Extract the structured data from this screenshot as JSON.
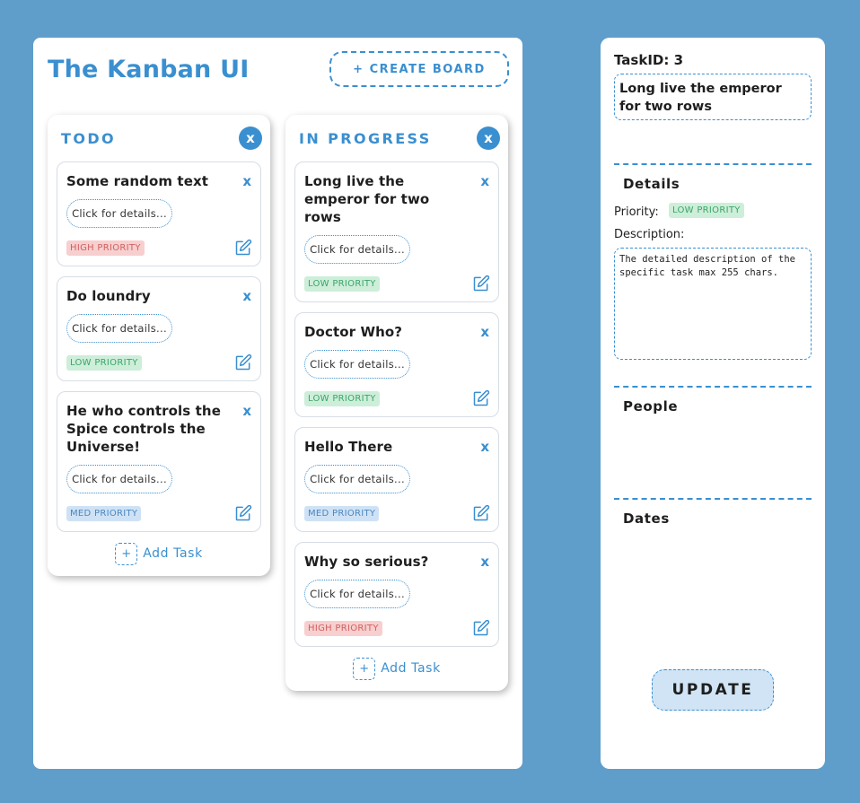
{
  "app": {
    "title": "The Kanban UI",
    "create_board_label": "+ CREATE BOARD"
  },
  "columns": [
    {
      "title": "TODO",
      "close_label": "x",
      "add_task_icon": "+",
      "add_task_label": "Add Task",
      "cards": [
        {
          "title": "Some random text",
          "close": "x",
          "details": "Click for details...",
          "priority": "HIGH PRIORITY",
          "level": "high"
        },
        {
          "title": "Do loundry",
          "close": "x",
          "details": "Click for details...",
          "priority": "LOW PRIORITY",
          "level": "low"
        },
        {
          "title": "He who controls the Spice controls the Universe!",
          "close": "x",
          "details": "Click for details...",
          "priority": "MED PRIORITY",
          "level": "med"
        }
      ]
    },
    {
      "title": "IN PROGRESS",
      "close_label": "x",
      "add_task_icon": "+",
      "add_task_label": "Add Task",
      "cards": [
        {
          "title": "Long live the emperor for two rows",
          "close": "x",
          "details": "Click for details...",
          "priority": "LOW PRIORITY",
          "level": "low"
        },
        {
          "title": "Doctor Who?",
          "close": "x",
          "details": "Click for details...",
          "priority": "LOW PRIORITY",
          "level": "low"
        },
        {
          "title": "Hello There",
          "close": "x",
          "details": "Click for details...",
          "priority": "MED PRIORITY",
          "level": "med"
        },
        {
          "title": "Why so serious?",
          "close": "x",
          "details": "Click for details...",
          "priority": "HIGH PRIORITY",
          "level": "high"
        }
      ]
    }
  ],
  "panel": {
    "task_id": "TaskID: 3",
    "task_title": "Long live the emperor for two rows",
    "details_heading": "Details",
    "priority_label": "Priority:",
    "priority_value": "LOW PRIORITY",
    "description_label": "Description:",
    "description": "The detailed description of the specific task max 255 chars.",
    "people_heading": "People",
    "dates_heading": "Dates",
    "update_label": "UPDATE"
  },
  "colors": {
    "background": "#5f9ecb",
    "accent": "#3a8fd0",
    "high": "#f7cfcf",
    "low": "#cdeed9",
    "med": "#cfe2f5"
  },
  "icons": {
    "edit": "edit-icon",
    "close": "close-icon",
    "add": "plus-icon"
  }
}
